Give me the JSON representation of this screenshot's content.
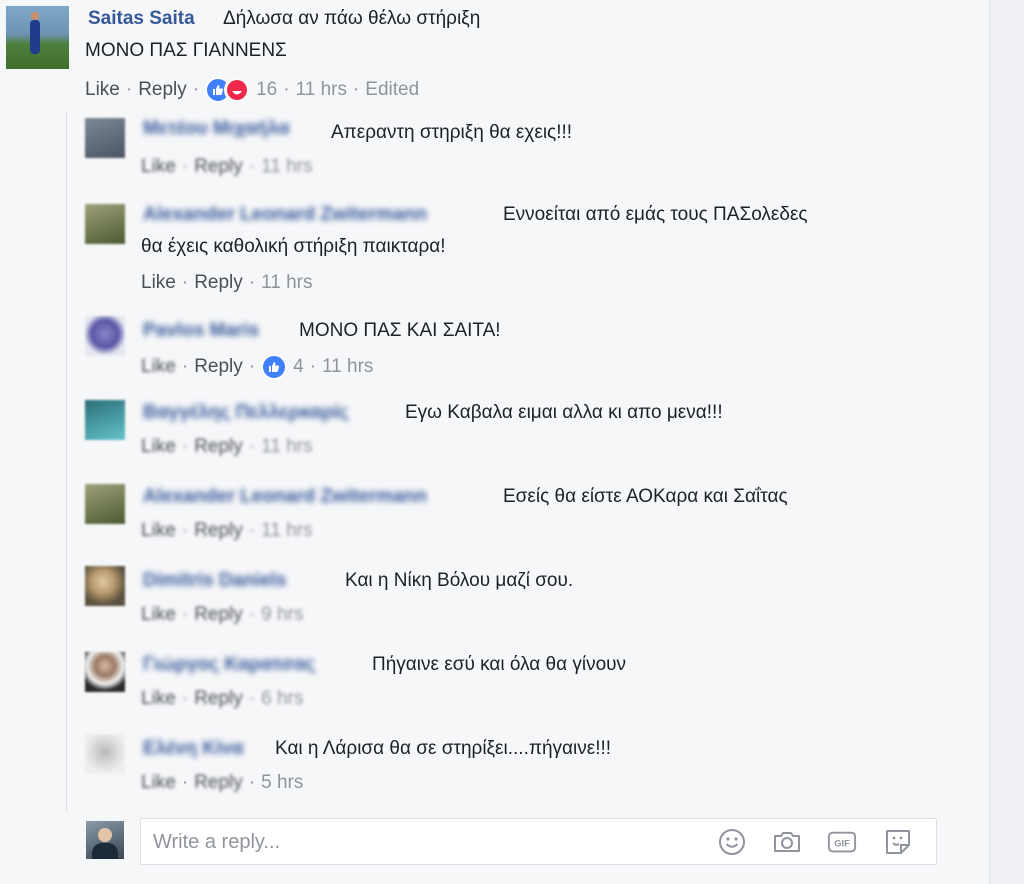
{
  "colors": {
    "link_blue": "#365899",
    "meta_gray": "#90949c",
    "background": "#f6f7f9",
    "like_blue": "#4080ff"
  },
  "main_comment": {
    "author": "Saitas Saita",
    "text_line1": "Δήλωσα αν πάω θέλω στήριξη",
    "text_line2": "ΜΟΝΟ ΠΑΣ ΓΙΑΝΝΕΝΣ",
    "like_label": "Like",
    "reply_label": "Reply",
    "reaction_icons": [
      "like-icon",
      "haha-icon"
    ],
    "reaction_count": "16",
    "time": "11 hrs",
    "edited": "Edited"
  },
  "replies": [
    {
      "text": "Απεραντη στηριξη θα εχεις!!!",
      "like_label": "Like",
      "reply_label": "Reply",
      "time": "11 hrs"
    },
    {
      "text_line1": "Εννοείται από εμάς τους ΠΑΣολεδες",
      "text_line2": "θα έχεις καθολική στήριξη παικταρα!",
      "like_label": "Like",
      "reply_label": "Reply",
      "time": "11 hrs"
    },
    {
      "text": "ΜΟΝΟ ΠΑΣ ΚΑΙ ΣΑΙΤΑ!",
      "like_label": "Like",
      "reply_label": "Reply",
      "reaction_count": "4",
      "time": "11 hrs"
    },
    {
      "text": "Εγω Καβαλα ειμαι αλλα κι απο μενα!!!",
      "like_label": "Like",
      "reply_label": "Reply",
      "time": "11 hrs"
    },
    {
      "text": "Εσείς θα είστε ΑΟΚαρα και Σαΐτας",
      "like_label": "Like",
      "reply_label": "Reply",
      "time": "11 hrs"
    },
    {
      "text": "Και η Νίκη Βόλου μαζί σου.",
      "like_label": "Like",
      "reply_label": "Reply",
      "time": "9 hrs"
    },
    {
      "text": "Πήγαινε εσύ και όλα θα γίνουν",
      "like_label": "Like",
      "reply_label": "Reply",
      "time": "6 hrs"
    },
    {
      "text": "Και η Λάρισα θα σε στηρίξει....πήγαινε!!!",
      "like_label": "Like",
      "reply_label": "Reply",
      "time": "5 hrs"
    }
  ],
  "composer": {
    "placeholder": "Write a reply...",
    "icons": [
      "emoji-icon",
      "camera-icon",
      "gif-icon",
      "sticker-icon"
    ],
    "gif_label": "GIF"
  }
}
